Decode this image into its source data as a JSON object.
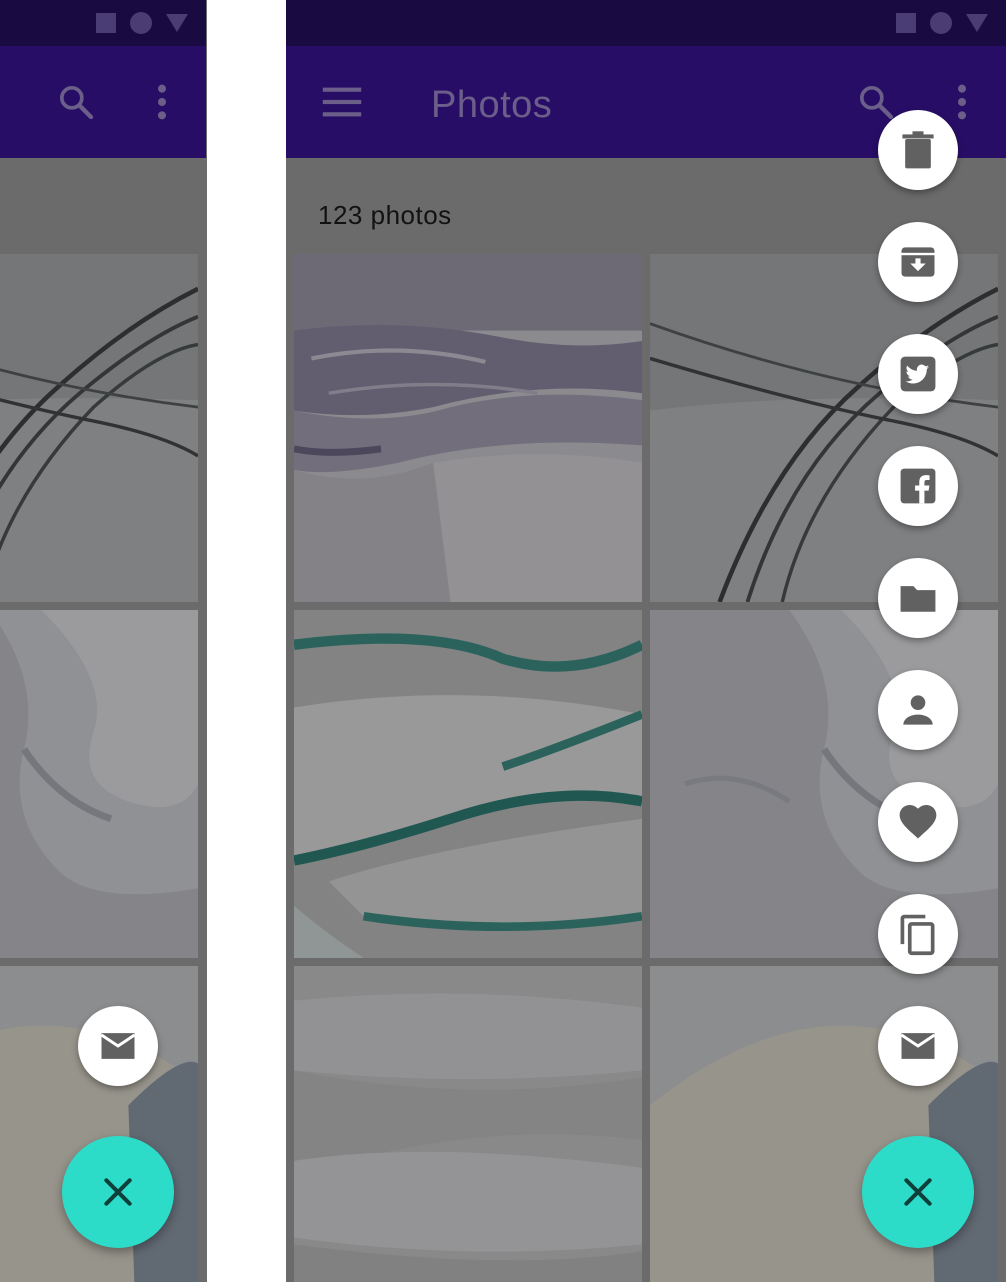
{
  "colors": {
    "status_bar": "#25105e",
    "app_bar": "#3a1493",
    "fab": "#2ddcc8",
    "mini_fab": "#ffffff",
    "scrim": "rgba(0,0,0,0.30)"
  },
  "left_screen": {
    "app_bar": {
      "actions": [
        "search-icon",
        "more-vert-icon"
      ]
    },
    "mini_fabs": [
      {
        "icon": "email-icon"
      }
    ],
    "main_fab": {
      "icon": "close-icon"
    }
  },
  "right_screen": {
    "app_bar": {
      "title": "Photos",
      "nav_icon": "menu-icon",
      "actions": [
        "search-icon",
        "more-vert-icon"
      ]
    },
    "photo_count": "123 photos",
    "mini_fabs": [
      {
        "icon": "delete-icon"
      },
      {
        "icon": "archive-icon"
      },
      {
        "icon": "twitter-icon"
      },
      {
        "icon": "facebook-icon"
      },
      {
        "icon": "folder-icon"
      },
      {
        "icon": "person-icon"
      },
      {
        "icon": "favorite-icon"
      },
      {
        "icon": "copy-icon"
      },
      {
        "icon": "email-icon"
      }
    ],
    "main_fab": {
      "icon": "close-icon"
    }
  }
}
